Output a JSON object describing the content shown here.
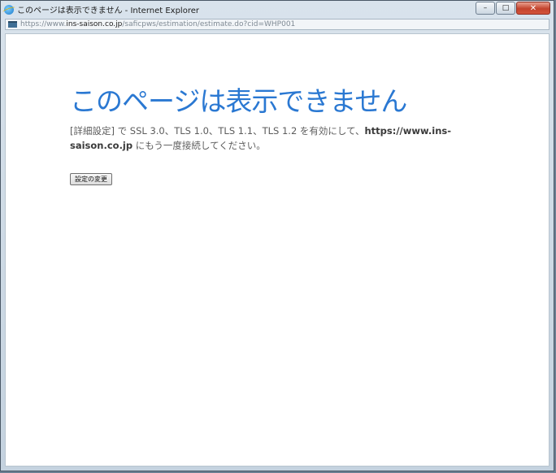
{
  "window": {
    "title": "このページは表示できません - Internet Explorer",
    "controls": {
      "minimize": "–",
      "maximize": "□",
      "close": "✕"
    }
  },
  "address": {
    "url_prefix": "https://www.",
    "url_host": "ins-saison.co.jp",
    "url_path": "/saficpws/estimation/estimate.do?cid=WHP001"
  },
  "page": {
    "heading": "このページは表示できません",
    "message_part1": "[詳細設定] で SSL 3.0、TLS 1.0、TLS 1.1、TLS 1.2 を有効にして、",
    "message_bold": "https://www.ins-saison.co.jp",
    "message_part2": " にもう一度接続してください。",
    "settings_button": "設定の変更"
  }
}
